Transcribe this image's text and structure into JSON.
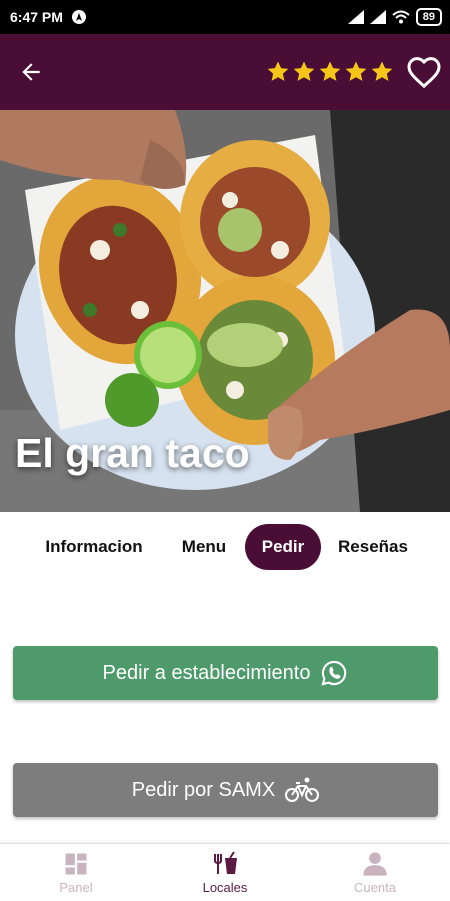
{
  "status_bar": {
    "time": "6:47 PM",
    "battery": "89"
  },
  "header": {
    "rating": 5,
    "star_color": "#f5c518",
    "background": "#4a0e36"
  },
  "restaurant": {
    "name": "El gran taco"
  },
  "tabs": [
    {
      "label": "Informacion",
      "active": false
    },
    {
      "label": "Menu",
      "active": false
    },
    {
      "label": "Pedir",
      "active": true
    },
    {
      "label": "Reseñas",
      "active": false
    }
  ],
  "actions": {
    "order_establishment": {
      "label": "Pedir a establecimiento",
      "icon": "whatsapp-icon",
      "color": "#4e9a6b"
    },
    "order_samx": {
      "label": "Pedir por SAMX",
      "icon": "bicycle-icon",
      "color": "#7d7d7d"
    }
  },
  "bottom_nav": [
    {
      "label": "Panel",
      "icon": "dashboard-icon",
      "active": false
    },
    {
      "label": "Locales",
      "icon": "restaurant-icon",
      "active": true
    },
    {
      "label": "Cuenta",
      "icon": "person-icon",
      "active": false
    }
  ]
}
